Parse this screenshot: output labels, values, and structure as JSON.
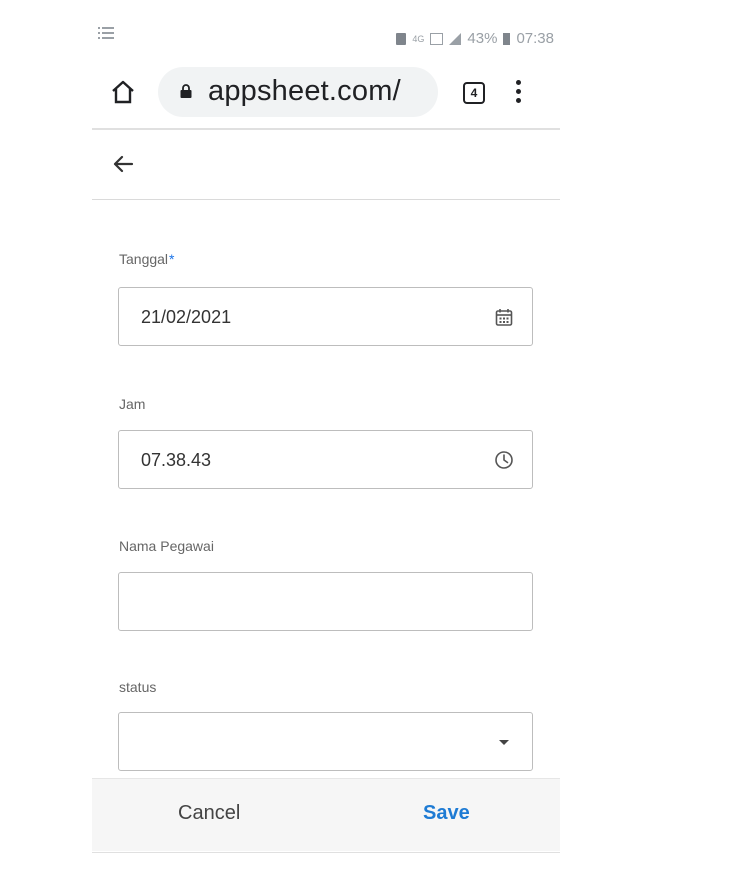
{
  "status_bar": {
    "battery_percent": "43%",
    "time": "07:38",
    "network_badge": "4G"
  },
  "browser": {
    "url": "appsheet.com/",
    "tab_count": "4"
  },
  "form": {
    "fields": [
      {
        "label": "Tanggal",
        "required_mark": "*",
        "value": "21/02/2021",
        "icon": "calendar-icon"
      },
      {
        "label": "Jam",
        "value": "07.38.43",
        "icon": "clock-icon"
      },
      {
        "label": "Nama Pegawai",
        "value": ""
      },
      {
        "label": "status",
        "value": "",
        "icon": "dropdown-arrow-icon"
      }
    ]
  },
  "footer": {
    "cancel_label": "Cancel",
    "save_label": "Save"
  },
  "colors": {
    "accent": "#1e7bd4",
    "required": "#1a73e8",
    "url_pill": "#f1f3f4",
    "footer_bg": "#f6f6f6"
  }
}
